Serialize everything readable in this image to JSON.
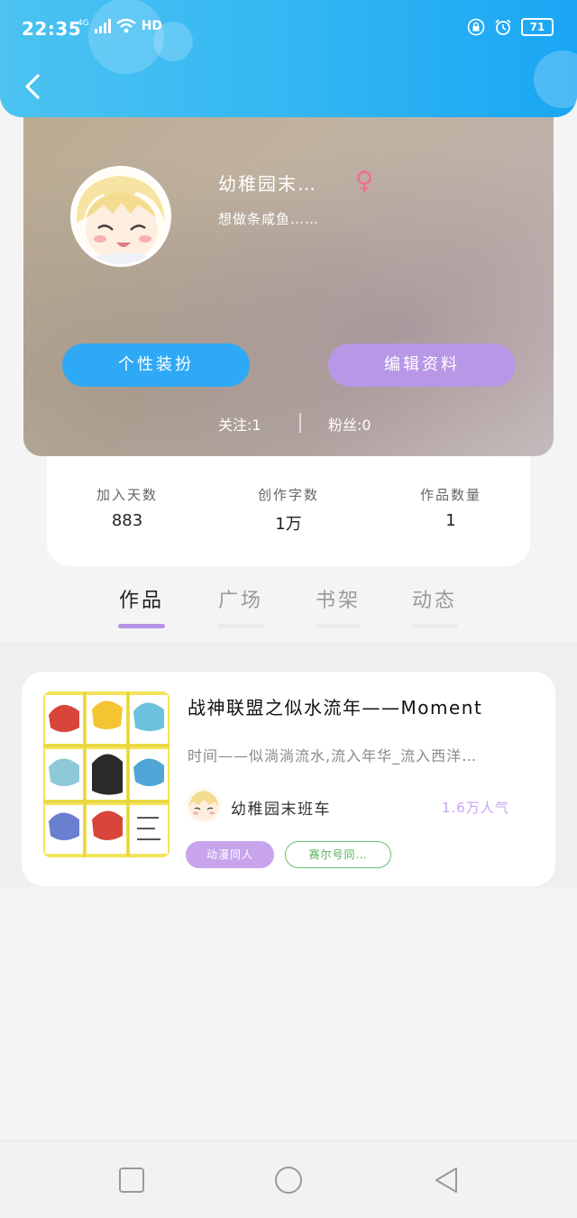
{
  "status_bar": {
    "time": "22:35",
    "network": "4G",
    "hd": "HD",
    "battery": "71"
  },
  "profile": {
    "username": "幼稚园末…",
    "gender_symbol": "♀",
    "signature": "想做条咸鱼……",
    "decorate_label": "个性装扮",
    "edit_label": "编辑资料",
    "following": "关注:1",
    "fans": "粉丝:0"
  },
  "stats": [
    {
      "label": "加入天数",
      "value": "883"
    },
    {
      "label": "创作字数",
      "value": "1万"
    },
    {
      "label": "作品数量",
      "value": "1"
    }
  ],
  "tabs": [
    {
      "label": "作品",
      "active": true
    },
    {
      "label": "广场",
      "active": false
    },
    {
      "label": "书架",
      "active": false
    },
    {
      "label": "动态",
      "active": false
    }
  ],
  "work": {
    "title": "战神联盟之似水流年——Moment",
    "description": "时间——似淌淌流水,流入年华_流入西洋…",
    "author": "幼稚园末班车",
    "popularity": "1.6万人气",
    "tags": [
      "动漫同人",
      "赛尔号同…"
    ]
  },
  "colors": {
    "header_blue": "#2fb4f3",
    "accent_purple": "#b494e6",
    "button_blue": "#2ea9f5",
    "tag_green": "#55b055",
    "gender_pink": "#f26d8e"
  }
}
